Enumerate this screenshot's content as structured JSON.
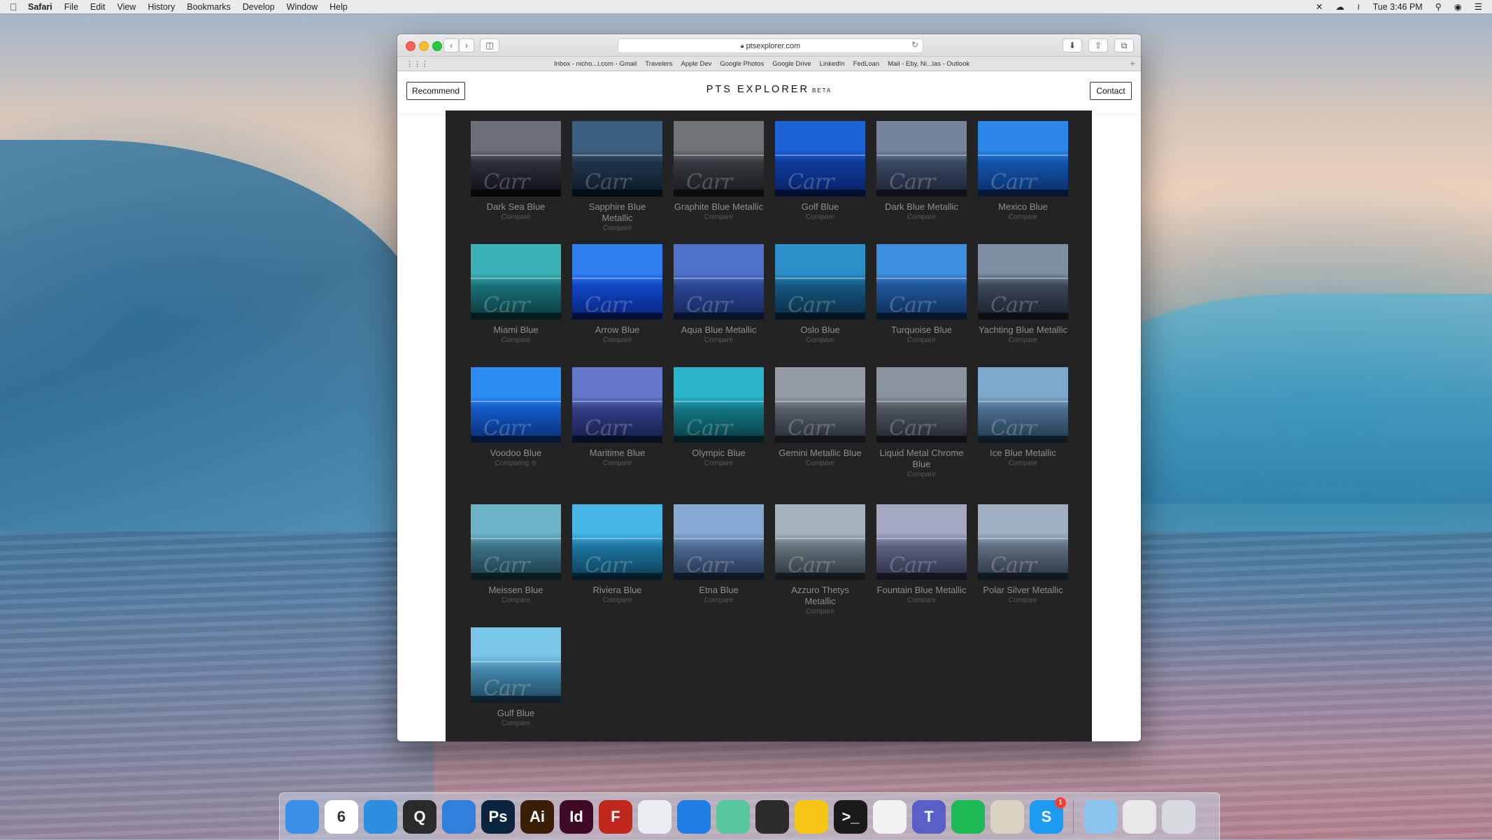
{
  "menubar": {
    "app": "Safari",
    "items": [
      "File",
      "Edit",
      "View",
      "History",
      "Bookmarks",
      "Develop",
      "Window",
      "Help"
    ],
    "clock": "Tue 3:46 PM"
  },
  "browser": {
    "url": "ptsexplorer.com",
    "bookmarks": [
      "Inbox - nicho...i.com - Gmail",
      "Travelers",
      "Apple Dev",
      "Google Photos",
      "Google Drive",
      "LinkedIn",
      "FedLoan",
      "Mail - Eby, Ni...las - Outlook"
    ]
  },
  "page": {
    "brand": "PTS EXPLORER",
    "beta": "BETA",
    "recommend_label": "Recommend",
    "contact_label": "Contact"
  },
  "swatches": [
    {
      "name": "Dark Sea Blue",
      "status": "Compare",
      "top": "#6b6f78",
      "mid": "#2a2e36",
      "bot": "#0d0f14"
    },
    {
      "name": "Sapphire Blue Metallic",
      "status": "Compare",
      "top": "#3d5f7f",
      "mid": "#203449",
      "bot": "#0b1826"
    },
    {
      "name": "Graphite Blue Metallic",
      "status": "Compare",
      "top": "#6f7479",
      "mid": "#35393e",
      "bot": "#15181b"
    },
    {
      "name": "Golf Blue",
      "status": "Compare",
      "top": "#1d62d6",
      "mid": "#0f3b9a",
      "bot": "#061f63"
    },
    {
      "name": "Dark Blue Metallic",
      "status": "Compare",
      "top": "#7585a0",
      "mid": "#3a4760",
      "bot": "#1a2233"
    },
    {
      "name": "Mexico Blue",
      "status": "Compare",
      "top": "#2b86e8",
      "mid": "#1453a8",
      "bot": "#082d66"
    },
    {
      "name": "Miami Blue",
      "status": "Compare",
      "top": "#3bb2b8",
      "mid": "#197178",
      "bot": "#08373b"
    },
    {
      "name": "Arrow Blue",
      "status": "Compare",
      "top": "#2f7ff0",
      "mid": "#1146c4",
      "bot": "#06237a"
    },
    {
      "name": "Aqua Blue Metallic",
      "status": "Compare",
      "top": "#4f72c8",
      "mid": "#2a4692",
      "bot": "#14245a"
    },
    {
      "name": "Oslo Blue",
      "status": "Compare",
      "top": "#2d8fc8",
      "mid": "#17567e",
      "bot": "#082a42"
    },
    {
      "name": "Turquoise Blue",
      "status": "Compare",
      "top": "#3d8ee0",
      "mid": "#1f5598",
      "bot": "#0c2b55"
    },
    {
      "name": "Yachting Blue Metallic",
      "status": "Compare",
      "top": "#7e8ea3",
      "mid": "#3c4656",
      "bot": "#181e28"
    },
    {
      "name": "Voodoo Blue",
      "status": "Comparing ⊘",
      "top": "#2b8cf2",
      "mid": "#1259c6",
      "bot": "#072d6f"
    },
    {
      "name": "Maritime Blue",
      "status": "Compare",
      "top": "#6477c8",
      "mid": "#313f85",
      "bot": "#141c47"
    },
    {
      "name": "Olympic Blue",
      "status": "Compare",
      "top": "#2ab5cc",
      "mid": "#137683",
      "bot": "#063a42"
    },
    {
      "name": "Gemini Metallic Blue",
      "status": "Compare",
      "top": "#959ca6",
      "mid": "#585f69",
      "bot": "#22272e"
    },
    {
      "name": "Liquid Metal Chrome Blue",
      "status": "Compare",
      "top": "#8a939e",
      "mid": "#4d545e",
      "bot": "#1e232a"
    },
    {
      "name": "Ice Blue Metallic",
      "status": "Compare",
      "top": "#7fa9cc",
      "mid": "#4a6f8e",
      "bot": "#1f3447"
    },
    {
      "name": "Meissen Blue",
      "status": "Compare",
      "top": "#6cb4c8",
      "mid": "#3e7386",
      "bot": "#173744"
    },
    {
      "name": "Riviera Blue",
      "status": "Compare",
      "top": "#45b6e6",
      "mid": "#1f76a2",
      "bot": "#0a3b55"
    },
    {
      "name": "Etna Blue",
      "status": "Compare",
      "top": "#86a9d4",
      "mid": "#4d6a93",
      "bot": "#1f2f47"
    },
    {
      "name": "Azzuro Thetys Metallic",
      "status": "Compare",
      "top": "#a4b3bd",
      "mid": "#66737c",
      "bot": "#283138"
    },
    {
      "name": "Fountain Blue Metallic",
      "status": "Compare",
      "top": "#a4a8c2",
      "mid": "#5e6383",
      "bot": "#262a40"
    },
    {
      "name": "Polar Silver Metallic",
      "status": "Compare",
      "top": "#a1afc3",
      "mid": "#616f83",
      "bot": "#252f3d"
    },
    {
      "name": "Gulf Blue",
      "status": "Compare",
      "top": "#7ac6ea",
      "mid": "#4589ad",
      "bot": "#1a4358"
    }
  ],
  "dock": [
    {
      "label": "",
      "name": "finder-icon",
      "color": "#3a8ee6"
    },
    {
      "label": "6",
      "name": "calendar-icon",
      "color": "#ffffff"
    },
    {
      "label": "",
      "name": "safari-icon",
      "color": "#2f8de0"
    },
    {
      "label": "Q",
      "name": "quicktime-icon",
      "color": "#2a2a2a"
    },
    {
      "label": "",
      "name": "xcode-icon",
      "color": "#2f7fdb"
    },
    {
      "label": "Ps",
      "name": "photoshop-icon",
      "color": "#0b2440"
    },
    {
      "label": "Ai",
      "name": "illustrator-icon",
      "color": "#3a1e05"
    },
    {
      "label": "Id",
      "name": "indesign-icon",
      "color": "#3f0a24"
    },
    {
      "label": "F",
      "name": "filezilla-icon",
      "color": "#c0271c"
    },
    {
      "label": "",
      "name": "airmail-icon",
      "color": "#e9eef2"
    },
    {
      "label": "",
      "name": "maps-pin-icon",
      "color": "#1e7ee6"
    },
    {
      "label": "",
      "name": "atom-icon",
      "color": "#56c79a"
    },
    {
      "label": "",
      "name": "compass-app-icon",
      "color": "#2b2b2b"
    },
    {
      "label": "",
      "name": "duck-app-icon",
      "color": "#f5c518"
    },
    {
      "label": ">_",
      "name": "terminal-icon",
      "color": "#1a1a1a"
    },
    {
      "label": "",
      "name": "textedit-icon",
      "color": "#f2f2f2"
    },
    {
      "label": "T",
      "name": "teams-icon",
      "color": "#5a5fc7"
    },
    {
      "label": "",
      "name": "spotify-icon",
      "color": "#1db954"
    },
    {
      "label": "",
      "name": "decoder-pro-icon",
      "color": "#d9d3c4"
    },
    {
      "label": "S",
      "name": "skype-icon",
      "color": "#1d9bf0",
      "badge": "1"
    }
  ],
  "dock_right": [
    {
      "label": "",
      "name": "downloads-folder-icon",
      "color": "#8cc4f0"
    },
    {
      "label": "",
      "name": "preview-stack-icon",
      "color": "#e8e8e8"
    },
    {
      "label": "",
      "name": "trash-icon",
      "color": "#d6d9dd"
    }
  ]
}
